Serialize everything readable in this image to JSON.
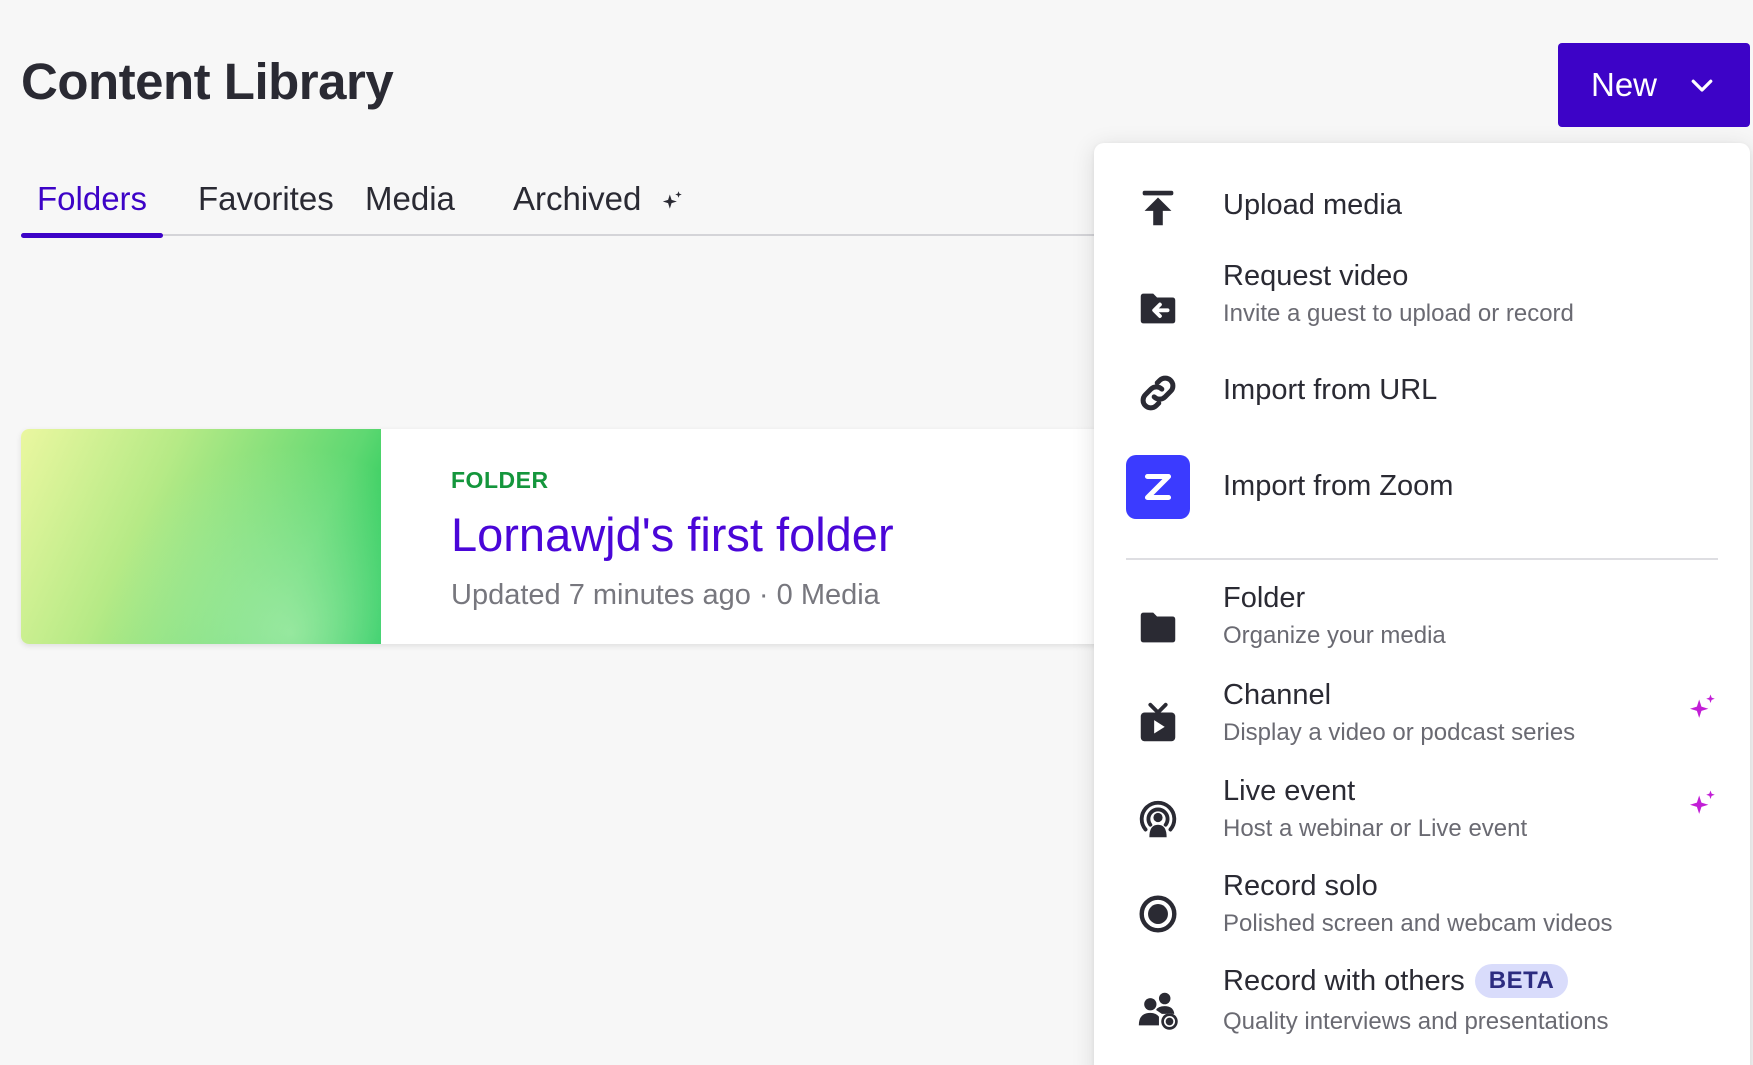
{
  "header": {
    "title": "Content Library",
    "new_button_label": "New"
  },
  "tabs": [
    {
      "label": "Folders",
      "active": true
    },
    {
      "label": "Favorites",
      "active": false
    },
    {
      "label": "Media",
      "active": false
    },
    {
      "label": "Archived",
      "active": false
    }
  ],
  "folder_card": {
    "type_label": "FOLDER",
    "name": "Lornawjd's first folder",
    "meta": "Updated 7 minutes ago · 0 Media"
  },
  "new_menu": {
    "items": [
      {
        "label": "Upload media",
        "description": "",
        "icon": "upload-icon"
      },
      {
        "label": "Request video",
        "description": "Invite a guest to upload or record",
        "icon": "folder-arrow-icon"
      },
      {
        "label": "Import from URL",
        "description": "",
        "icon": "link-icon"
      },
      {
        "label": "Import from Zoom",
        "description": "",
        "icon": "zoom-icon"
      },
      {
        "label": "Folder",
        "description": "Organize your media",
        "icon": "folder-icon"
      },
      {
        "label": "Channel",
        "description": "Display a video or podcast series",
        "icon": "tv-icon",
        "sparkle": true
      },
      {
        "label": "Live event",
        "description": "Host a webinar or Live event",
        "icon": "broadcast-icon",
        "sparkle": true
      },
      {
        "label": "Record solo",
        "description": "Polished screen and webcam videos",
        "icon": "record-icon"
      },
      {
        "label": "Record with others",
        "description": "Quality interviews and presentations",
        "icon": "people-record-icon",
        "badge": "BETA"
      }
    ]
  },
  "colors": {
    "accent": "#3d03c7",
    "folder_link": "#4a06d8",
    "folder_type": "#14963c",
    "sparkle": "#c21ed6",
    "zoom": "#3b3bff"
  }
}
